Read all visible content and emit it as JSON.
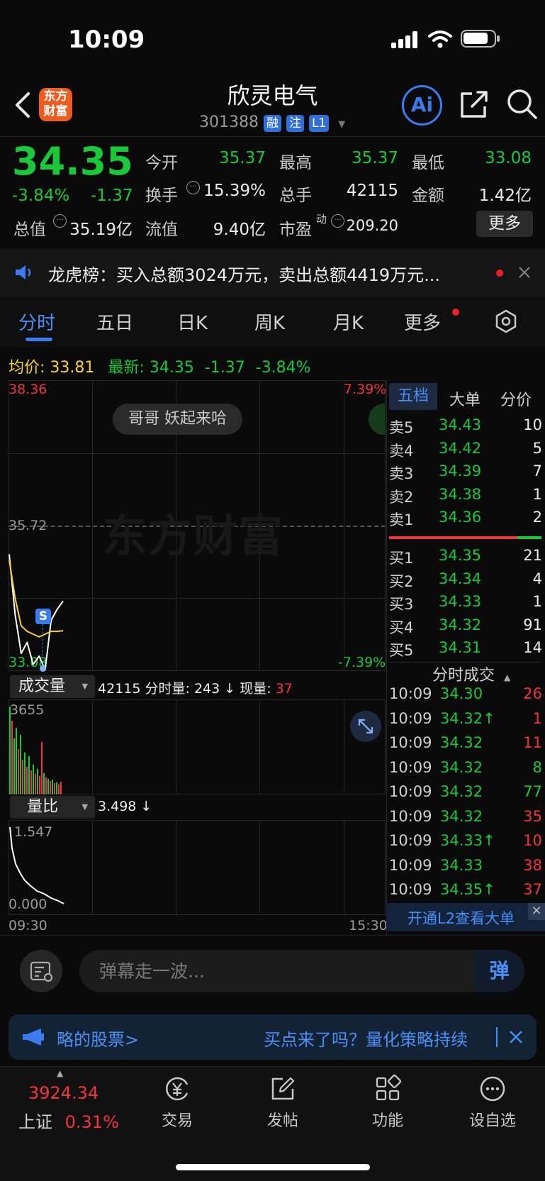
{
  "status_bar": {
    "time": "10:09"
  },
  "header": {
    "logo_text_1": "东方",
    "logo_text_2": "财富",
    "name": "欣灵电气",
    "code": "301388",
    "tags": [
      "融",
      "注",
      "L1"
    ],
    "ai_label": "Ai"
  },
  "quote": {
    "price": "34.35",
    "change_pct": "-3.84%",
    "change": "-1.37",
    "open_label": "今开",
    "open": "35.37",
    "high_label": "最高",
    "high": "35.37",
    "low_label": "最低",
    "low": "33.08",
    "turnover_label": "换手",
    "turnover": "15.39%",
    "volume_label": "总手",
    "volume": "42115",
    "amount_label": "金额",
    "amount": "1.42亿",
    "mktcap_label": "总值",
    "mktcap": "35.19亿",
    "float_label": "流值",
    "float": "9.40亿",
    "pe_label": "市盈",
    "pe_sup": "动",
    "pe": "209.20",
    "more_label": "更多"
  },
  "notice": {
    "text": "龙虎榜：买入总额3024万元，卖出总额4419万元..."
  },
  "tabs": [
    "分时",
    "五日",
    "日K",
    "周K",
    "月K",
    "更多"
  ],
  "info_line": {
    "avg_label": "均价:",
    "avg": "33.81",
    "latest_label": "最新:",
    "latest": "34.35",
    "change": "-1.37",
    "change_pct": "-3.84%"
  },
  "chart": {
    "y_top": "38.36",
    "y_mid": "35.72",
    "y_bottom": "33.08",
    "pct_top": "7.39%",
    "pct_bottom": "-7.39%",
    "bubble": "哥哥 妖起来哈",
    "watermark": "东方财富",
    "marker": "S",
    "vol_selector": "成交量",
    "vol_info_total": "42115",
    "vol_info_label": "分时量:",
    "vol_info_value": "243 ↓",
    "vol_now_label": "现量:",
    "vol_now_value": "37",
    "vol_max": "3655",
    "ratio_selector": "量比",
    "ratio_value": "3.498 ↓",
    "ratio_max": "1.547",
    "ratio_min": "0.000",
    "time_start": "09:30",
    "time_end": "15:30"
  },
  "chart_data": {
    "type": "line",
    "x": [
      "09:30",
      "09:31",
      "09:32",
      "09:33",
      "09:34",
      "09:35",
      "09:36",
      "09:37",
      "09:38",
      "09:39"
    ],
    "series": [
      {
        "values": [
          35.2,
          34.1,
          33.4,
          33.6,
          33.2,
          33.35,
          33.1,
          34.0,
          34.2,
          34.35
        ]
      },
      {
        "values": [
          35.1,
          34.4,
          33.9,
          33.8,
          33.75,
          33.7,
          33.75,
          33.8,
          33.8,
          33.81
        ]
      }
    ],
    "ylim": [
      33.08,
      38.36
    ]
  },
  "order_book": {
    "tabs": [
      "五档",
      "大单",
      "分价"
    ],
    "asks": [
      {
        "label": "卖5",
        "price": "34.43",
        "vol": "10"
      },
      {
        "label": "卖4",
        "price": "34.42",
        "vol": "5"
      },
      {
        "label": "卖3",
        "price": "34.39",
        "vol": "7"
      },
      {
        "label": "卖2",
        "price": "34.38",
        "vol": "1"
      },
      {
        "label": "卖1",
        "price": "34.36",
        "vol": "2"
      }
    ],
    "bids": [
      {
        "label": "买1",
        "price": "34.35",
        "vol": "21"
      },
      {
        "label": "买2",
        "price": "34.34",
        "vol": "4"
      },
      {
        "label": "买3",
        "price": "34.33",
        "vol": "1"
      },
      {
        "label": "买4",
        "price": "34.32",
        "vol": "91"
      },
      {
        "label": "买5",
        "price": "34.31",
        "vol": "14"
      }
    ],
    "ticks_title": "分时成交",
    "ticks": [
      {
        "time": "10:09",
        "price": "34.30",
        "vol": "26"
      },
      {
        "time": "10:09",
        "price": "34.32↑",
        "vol": "1"
      },
      {
        "time": "10:09",
        "price": "34.32",
        "vol": "11"
      },
      {
        "time": "10:09",
        "price": "34.32",
        "vol": "8"
      },
      {
        "time": "10:09",
        "price": "34.32",
        "vol": "77"
      },
      {
        "time": "10:09",
        "price": "34.32",
        "vol": "35"
      },
      {
        "time": "10:09",
        "price": "34.33↑",
        "vol": "10"
      },
      {
        "time": "10:09",
        "price": "34.33",
        "vol": "38"
      },
      {
        "time": "10:09",
        "price": "34.35↑",
        "vol": "37"
      }
    ],
    "l2_banner": "开通L2查看大单"
  },
  "danmaku": {
    "placeholder": "弹幕走一波...",
    "send_label": "弹"
  },
  "promo": {
    "left_text": "略的股票>",
    "right_text": "买点来了吗？量化策略持续"
  },
  "bottom_nav": {
    "index_value": "3924.34",
    "index_name": "上证",
    "index_change": "0.31%",
    "items": [
      "交易",
      "发帖",
      "功能",
      "设自选"
    ]
  }
}
